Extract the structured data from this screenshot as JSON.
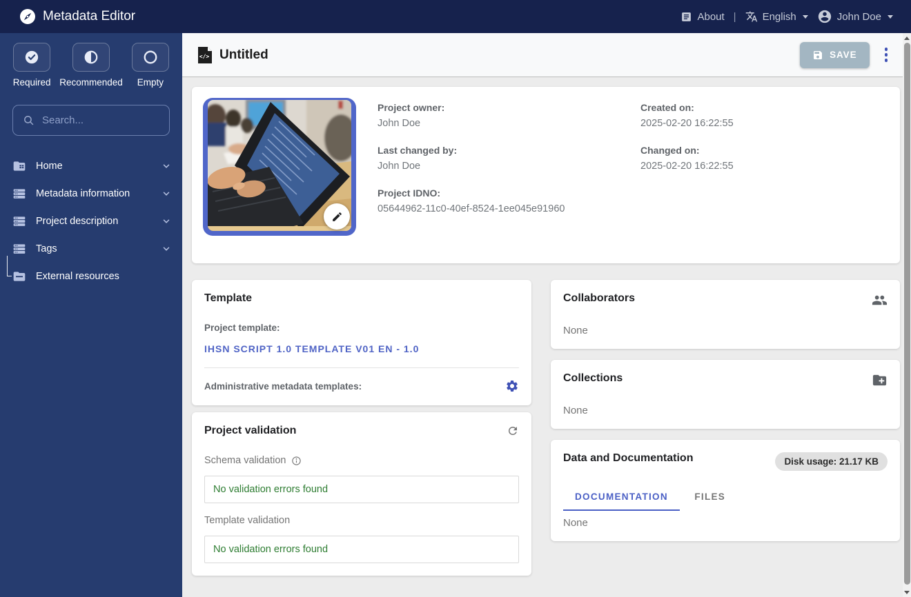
{
  "colors": {
    "navbar_bg": "#16224d",
    "sidebar_bg": "#263c6f",
    "accent_indigo": "#3f51b5",
    "link_blue": "#4f63c5",
    "success_green": "#2e7d32",
    "save_button_bg": "#a3b6c2",
    "thumb_frame_blue": "#5066c9"
  },
  "navbar": {
    "brand": "Metadata Editor",
    "about_label": "About",
    "separator": "|",
    "language_label": "English",
    "user_label": "John Doe"
  },
  "sidebar": {
    "filters": [
      {
        "label": "Required",
        "icon": "check-circle-icon"
      },
      {
        "label": "Recommended",
        "icon": "half-circle-icon"
      },
      {
        "label": "Empty",
        "icon": "empty-circle-icon"
      }
    ],
    "search": {
      "placeholder": "Search..."
    },
    "items": [
      {
        "label": "Home",
        "icon": "home-folder-icon",
        "expandable": true
      },
      {
        "label": "Metadata information",
        "icon": "stack-icon",
        "expandable": true
      },
      {
        "label": "Project description",
        "icon": "stack-icon",
        "expandable": true
      },
      {
        "label": "Tags",
        "icon": "stack-icon",
        "expandable": true
      },
      {
        "label": "External resources",
        "icon": "folder-icon",
        "expandable": false
      }
    ]
  },
  "header": {
    "title": "Untitled",
    "save_label": "SAVE"
  },
  "project": {
    "owner_label": "Project owner:",
    "owner_value": "John Doe",
    "last_changed_label": "Last changed by:",
    "last_changed_value": "John Doe",
    "idno_label": "Project IDNO:",
    "idno_value": "05644962-11c0-40ef-8524-1ee045e91960",
    "created_label": "Created on:",
    "created_value": "2025-02-20 16:22:55",
    "changed_label": "Changed on:",
    "changed_value": "2025-02-20 16:22:55"
  },
  "template_card": {
    "title": "Template",
    "project_template_label": "Project template:",
    "project_template_link": "IHSN SCRIPT 1.0 TEMPLATE V01 EN - 1.0",
    "admin_templates_label": "Administrative metadata templates:"
  },
  "validation_card": {
    "title": "Project validation",
    "schema_label": "Schema validation",
    "schema_result": "No validation errors found",
    "template_label": "Template validation",
    "template_result": "No validation errors found"
  },
  "collaborators_card": {
    "title": "Collaborators",
    "value": "None"
  },
  "collections_card": {
    "title": "Collections",
    "value": "None"
  },
  "data_card": {
    "title": "Data and Documentation",
    "disk_usage_badge": "Disk usage: 21.17 KB",
    "tabs": [
      {
        "label": "DOCUMENTATION",
        "active": true
      },
      {
        "label": "FILES",
        "active": false
      }
    ],
    "value": "None"
  }
}
